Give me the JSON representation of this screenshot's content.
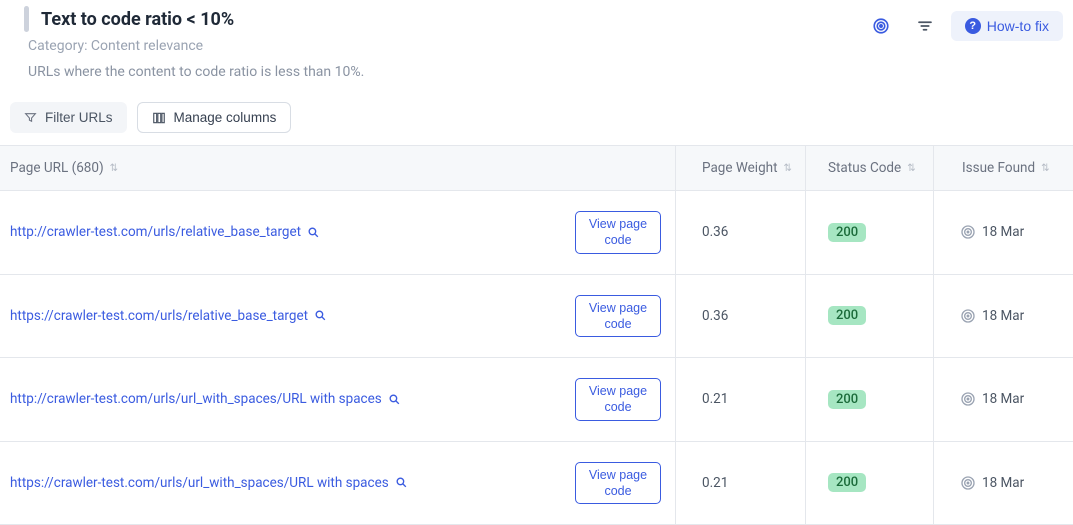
{
  "header": {
    "title": "Text to code ratio < 10%",
    "category_label": "Category: Content relevance",
    "description": "URLs where the content to code ratio is less than 10%."
  },
  "actions": {
    "target_icon": "target-icon",
    "settings_icon": "settings-icon",
    "howto_label": "How-to fix"
  },
  "filters": {
    "filter_label": "Filter URLs",
    "manage_label": "Manage columns"
  },
  "table": {
    "columns": {
      "url": "Page URL (680)",
      "weight": "Page Weight",
      "status": "Status Code",
      "found": "Issue Found"
    },
    "view_code_label": "View page code",
    "rows": [
      {
        "url": "http://crawler-test.com/urls/relative_base_target",
        "weight": "0.36",
        "status": "200",
        "found": "18 Mar"
      },
      {
        "url": "https://crawler-test.com/urls/relative_base_target",
        "weight": "0.36",
        "status": "200",
        "found": "18 Mar"
      },
      {
        "url": "http://crawler-test.com/urls/url_with_spaces/URL with spaces",
        "weight": "0.21",
        "status": "200",
        "found": "18 Mar"
      },
      {
        "url": "https://crawler-test.com/urls/url_with_spaces/URL with spaces",
        "weight": "0.21",
        "status": "200",
        "found": "18 Mar"
      }
    ]
  },
  "colors": {
    "accent": "#3a5be0",
    "status_ok_bg": "#a6e6c2",
    "status_ok_fg": "#1b6b3a"
  }
}
